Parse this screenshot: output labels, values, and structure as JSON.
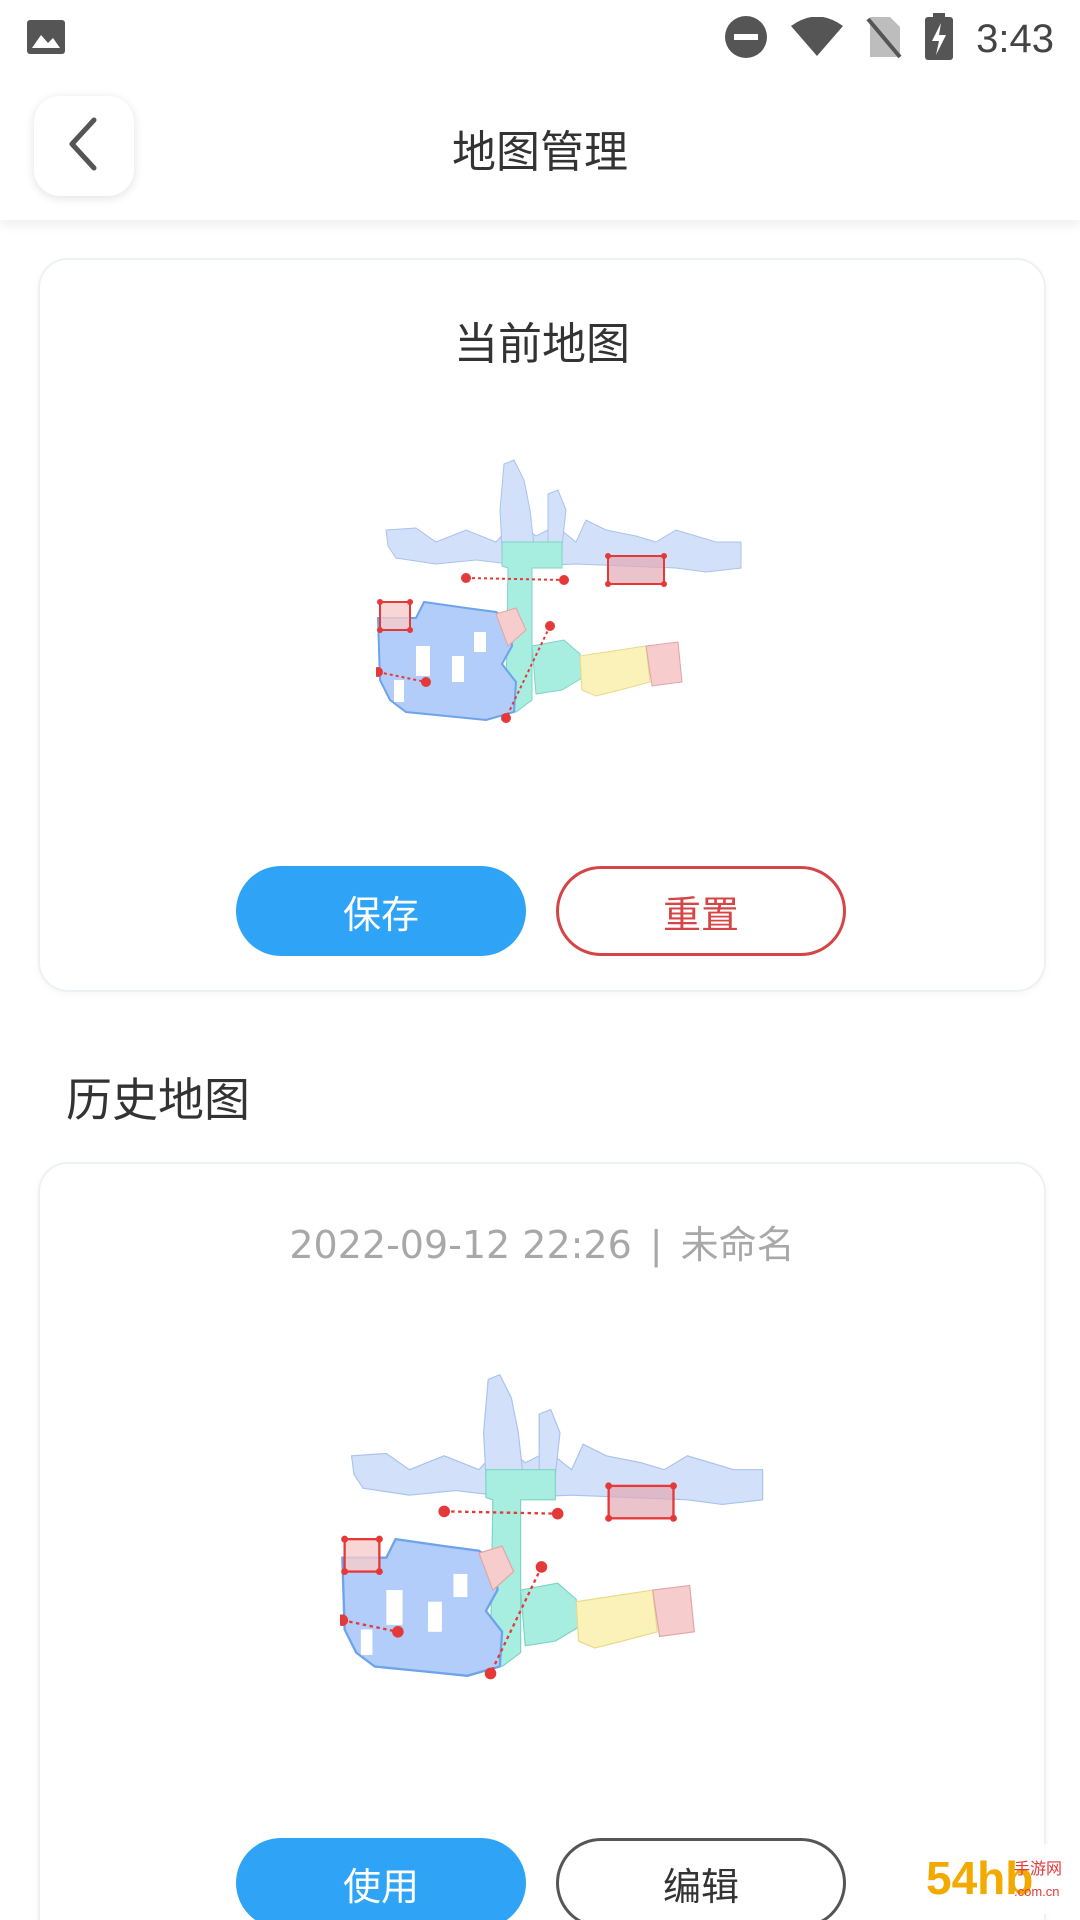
{
  "status_bar": {
    "time": "3:43",
    "icons": [
      "image-icon",
      "do-not-disturb-icon",
      "wifi-icon",
      "no-sim-icon",
      "battery-charging-icon"
    ]
  },
  "header": {
    "title": "地图管理"
  },
  "current_map": {
    "title": "当前地图",
    "save_label": "保存",
    "reset_label": "重置"
  },
  "history": {
    "section_title": "历史地图",
    "items": [
      {
        "date": "2022-09-12 22:26",
        "separator": "|",
        "name": "未命名",
        "use_label": "使用",
        "edit_label": "编辑"
      }
    ]
  },
  "colors": {
    "primary": "#2fa3f6",
    "danger": "#d64545",
    "room_blue": "#b2cdf9",
    "room_lightblue": "#d2e0f9",
    "room_teal": "#a8eee0",
    "room_yellow": "#faf2b8",
    "room_pink": "#f7cccc",
    "marker_red": "#e53939"
  },
  "watermark": {
    "text": "54hb",
    "sub": "手游网",
    "domain": ".com.cn"
  }
}
